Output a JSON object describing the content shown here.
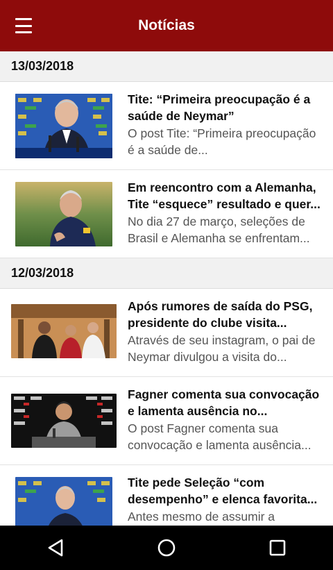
{
  "app_bar": {
    "title": "Notícias",
    "menu_icon": "hamburger-menu-icon"
  },
  "sections": [
    {
      "date": "13/03/2018",
      "items": [
        {
          "title": "Tite: “Primeira preocupação é a saúde de Neymar”",
          "excerpt": "O post Tite: “Primeira preocupação é a saúde de..."
        },
        {
          "title": "Em reencontro com a Alemanha, Tite “esquece” resultado e quer...",
          "excerpt": "No dia 27 de março, seleções de Brasil e Alemanha se enfrentam..."
        }
      ]
    },
    {
      "date": "12/03/2018",
      "items": [
        {
          "title": "Após rumores de saída do PSG, presidente do clube visita...",
          "excerpt": "Através de seu instagram, o pai de Neymar divulgou a visita do..."
        },
        {
          "title": "Fagner comenta sua convocação e lamenta ausência no...",
          "excerpt": "O post Fagner comenta sua convocação e lamenta ausência..."
        },
        {
          "title": "Tite pede Seleção “com desempenho” e elenca favorita...",
          "excerpt": "Antes mesmo de assumir a"
        }
      ]
    }
  ],
  "nav_bar": {
    "back_icon": "back-triangle-icon",
    "home_icon": "home-circle-icon",
    "recents_icon": "recents-square-icon"
  },
  "colors": {
    "app_bar": "#8e0b0b",
    "section_header_bg": "#f1f1f1",
    "nav_bar": "#000000"
  }
}
